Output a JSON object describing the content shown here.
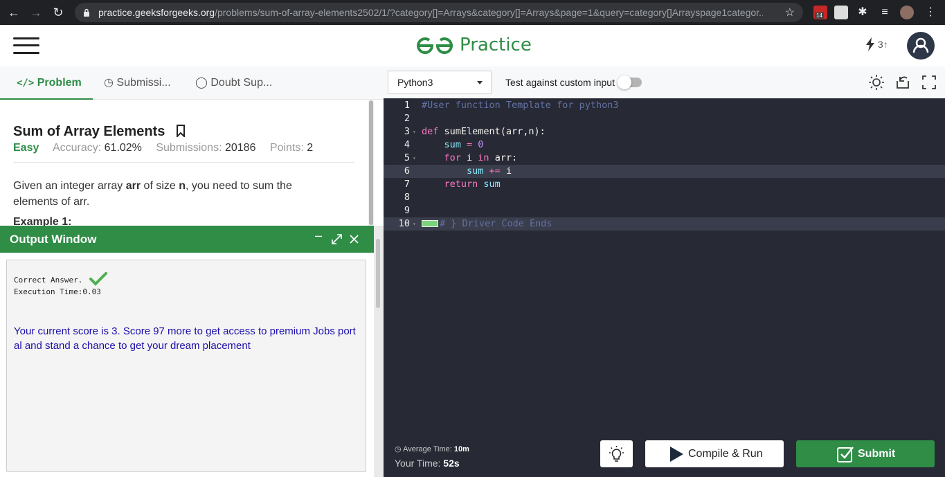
{
  "browser": {
    "url_host": "practice.geeksforgeeks.org",
    "url_path": "/problems/sum-of-array-elements2502/1/?category[]=Arrays&category[]=Arrays&page=1&query=category[]Arrayspage1categor...",
    "ext_badge": "14"
  },
  "header": {
    "logo_text": "Practice",
    "streak_count": "3"
  },
  "tabs": [
    {
      "label": "Problem"
    },
    {
      "label": "Submissi..."
    },
    {
      "label": "Doubt Sup..."
    }
  ],
  "problem": {
    "title": "Sum of Array Elements",
    "difficulty": "Easy",
    "accuracy_label": "Accuracy:",
    "accuracy_value": "61.02%",
    "submissions_label": "Submissions:",
    "submissions_value": "20186",
    "points_label": "Points:",
    "points_value": "2",
    "desc_1": "Given an integer array ",
    "desc_arr": "arr",
    "desc_2": " of size ",
    "desc_n": "n",
    "desc_3": ", you need to sum the elements of arr.",
    "example_heading": "Example 1:"
  },
  "output": {
    "title": "Output Window",
    "correct": "Correct Answer.",
    "exec_time": "Execution Time:0.03",
    "score_msg": "Your current score is 3. Score 97 more to get access to premium Jobs portal and stand a chance to get your dream placement"
  },
  "editor": {
    "language": "Python3",
    "custom_input_label": "Test against custom input",
    "custom_input_enabled": false,
    "lines": [
      {
        "n": "1",
        "parts": [
          {
            "t": "#User function Template for python3",
            "c": "c-cm"
          }
        ]
      },
      {
        "n": "2",
        "parts": []
      },
      {
        "n": "3",
        "fold": true,
        "parts": [
          {
            "t": "def ",
            "c": "c-kw"
          },
          {
            "t": "sumElement(arr,n):",
            "c": "c-fn"
          }
        ]
      },
      {
        "n": "4",
        "parts": [
          {
            "t": "    ",
            "c": ""
          },
          {
            "t": "sum",
            "c": "c-var"
          },
          {
            "t": " = ",
            "c": "c-kw"
          },
          {
            "t": "0",
            "c": "c-num"
          }
        ]
      },
      {
        "n": "5",
        "fold": true,
        "parts": [
          {
            "t": "    ",
            "c": ""
          },
          {
            "t": "for",
            "c": "c-kw"
          },
          {
            "t": " i ",
            "c": ""
          },
          {
            "t": "in",
            "c": "c-kw"
          },
          {
            "t": " arr:",
            "c": ""
          }
        ]
      },
      {
        "n": "6",
        "hl": true,
        "parts": [
          {
            "t": "        ",
            "c": ""
          },
          {
            "t": "sum",
            "c": "c-var"
          },
          {
            "t": " += ",
            "c": "c-kw"
          },
          {
            "t": "i",
            "c": ""
          }
        ]
      },
      {
        "n": "7",
        "parts": [
          {
            "t": "    ",
            "c": ""
          },
          {
            "t": "return",
            "c": "c-kw"
          },
          {
            "t": " sum",
            "c": "c-var"
          }
        ]
      },
      {
        "n": "8",
        "parts": []
      },
      {
        "n": "9",
        "parts": []
      },
      {
        "n": "10",
        "hl": true,
        "foldmark": true,
        "parts": [
          {
            "t": "# } Driver Code Ends",
            "c": "c-cm"
          }
        ]
      }
    ]
  },
  "footer": {
    "avg_time_label": "Average Time:",
    "avg_time_value": "10m",
    "your_time_label": "Your Time:",
    "your_time_value": "52s",
    "run_label": "Compile & Run",
    "submit_label": "Submit"
  },
  "colors": {
    "brand_green": "#2f8d46",
    "editor_bg": "#272935",
    "link_blue": "#1a0dab"
  }
}
